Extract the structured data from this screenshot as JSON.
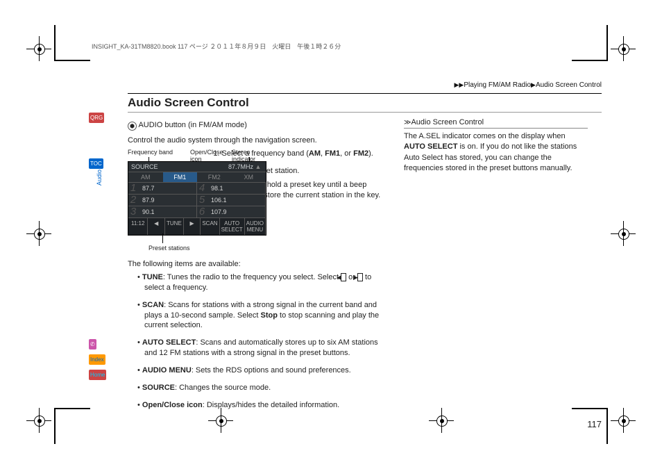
{
  "running_head": "INSIGHT_KA-31TM8820.book  117 ページ  ２０１１年８月９日　火曜日　午後１時２６分",
  "breadcrumb": {
    "a": "Playing FM/AM Radio",
    "b": "Audio Screen Control"
  },
  "title": "Audio Screen Control",
  "action_line": "AUDIO button (in FM/AM mode)",
  "intro": "Control the audio system through the navigation screen.",
  "callouts": {
    "freq_band": "Frequency band",
    "stereo": "Stereo indicator",
    "open_close": "Open/Close icon",
    "presets": "Preset stations"
  },
  "screen": {
    "source": "SOURCE",
    "tuner": "87.7MHz",
    "tabs": [
      "AM",
      "FM1",
      "FM2",
      "XM"
    ],
    "active_tab": 1,
    "presets": [
      [
        "87.7",
        "98.1"
      ],
      [
        "87.9",
        "106.1"
      ],
      [
        "90.1",
        "107.9"
      ]
    ],
    "nums_left": [
      "1",
      "2",
      "3"
    ],
    "nums_right": [
      "4",
      "5",
      "6"
    ],
    "clock": "11:12",
    "bottom": [
      "◀",
      "TUNE",
      "▶",
      "SCAN",
      "AUTO SELECT",
      "AUDIO MENU"
    ]
  },
  "steps": {
    "s1a": "Select a frequency band (",
    "s1b": "AM",
    "s1c": ", ",
    "s1d": "FM1",
    "s1e": ", or ",
    "s1f": "FM2",
    "s1g": ").",
    "s2": "Select a preset station.",
    "s2sub": "Touch and hold a preset key until a beep sounds to store the current station in the key."
  },
  "below_intro": "The following items are available:",
  "items": {
    "tune_l": "TUNE",
    "tune_a": ": Tunes the radio to the frequency you select. Select ",
    "tune_b": " or ",
    "tune_c": " to select a frequency.",
    "scan_l": "SCAN",
    "scan_a": ": Scans for stations with a strong signal in the current band and plays a 10-second sample. Select ",
    "scan_b": "Stop",
    "scan_c": " to stop scanning and play the current selection.",
    "auto_l": "AUTO SELECT",
    "auto_t": ": Scans and automatically stores up to six AM stations and 12 FM stations with a strong signal in the preset buttons.",
    "menu_l": "AUDIO MENU",
    "menu_t": ": Sets the RDS options and sound preferences.",
    "src_l": "SOURCE",
    "src_t": ": Changes the source mode.",
    "oc_l": "Open/Close icon",
    "oc_t": ": Displays/hides the detailed information."
  },
  "side": {
    "title": "Audio Screen Control",
    "body_a": "The A.SEL indicator comes on the display when ",
    "body_b": "AUTO SELECT",
    "body_c": " is on. If you do not like the stations Auto Select has stored, you can change the frequencies stored in the preset buttons manually."
  },
  "page_number": "117",
  "nav": {
    "qrg": "QRG",
    "toc": "TOC",
    "audio": "Audio",
    "index": "Index",
    "home": "Home"
  },
  "glyph": {
    "tri": "▶",
    "tri2": "▶▶",
    "left": "◀",
    "right": "▶"
  }
}
